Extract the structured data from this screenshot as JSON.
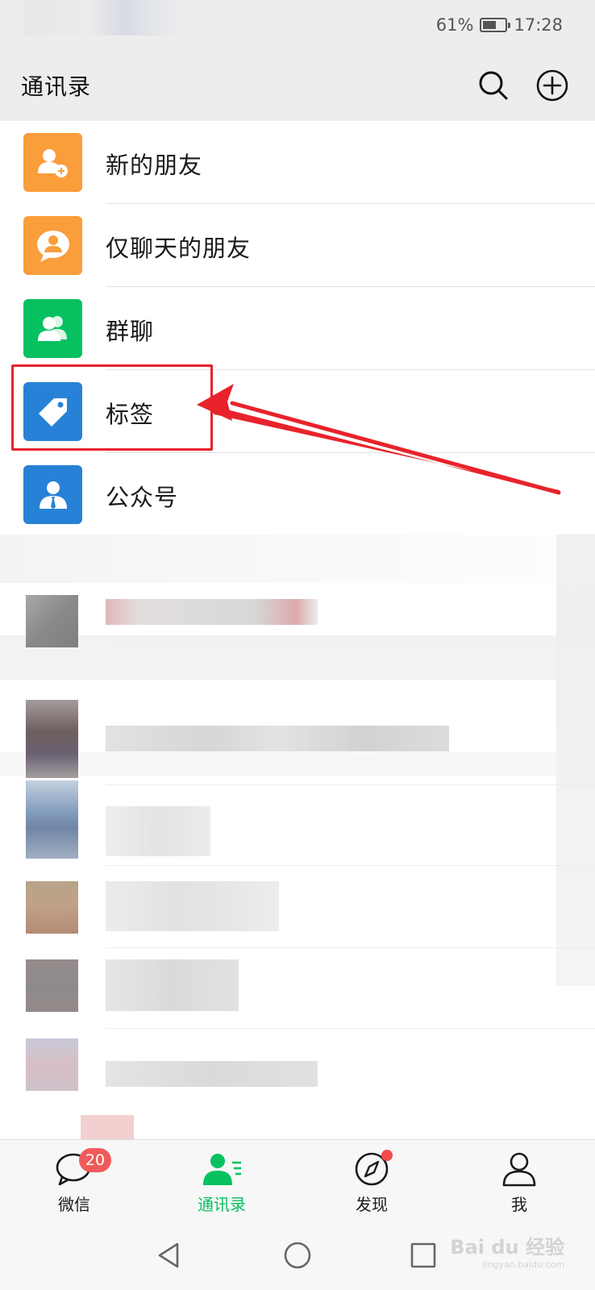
{
  "status_bar": {
    "battery": "61%",
    "battery_level": 0.61,
    "time": "17:28"
  },
  "header": {
    "title": "通讯录",
    "search_icon": "search-icon",
    "add_icon": "plus-circle-icon"
  },
  "menu": {
    "items": [
      {
        "label": "新的朋友",
        "icon": "add-friend-icon",
        "color": "#fa9d3b"
      },
      {
        "label": "仅聊天的朋友",
        "icon": "chat-friend-icon",
        "color": "#fa9d3b"
      },
      {
        "label": "群聊",
        "icon": "group-icon",
        "color": "#07c160"
      },
      {
        "label": "标签",
        "icon": "tag-icon",
        "color": "#2782d7"
      },
      {
        "label": "公众号",
        "icon": "official-account-icon",
        "color": "#2782d7"
      }
    ]
  },
  "annotation": {
    "color": "#e8232b",
    "target": "标签"
  },
  "tab_bar": {
    "tabs": [
      {
        "label": "微信",
        "icon": "chat-bubble-icon",
        "badge": "20"
      },
      {
        "label": "通讯录",
        "icon": "contacts-icon",
        "active": true
      },
      {
        "label": "发现",
        "icon": "compass-icon",
        "dot": true
      },
      {
        "label": "我",
        "icon": "person-icon"
      }
    ],
    "active_color": "#07c160"
  },
  "nav_bar": {
    "back_icon": "back-triangle-icon",
    "home_icon": "home-circle-icon",
    "recents_icon": "recents-square-icon"
  },
  "watermark": {
    "text": "Bai du 经验",
    "sub": "jingyan.baidu.com"
  }
}
